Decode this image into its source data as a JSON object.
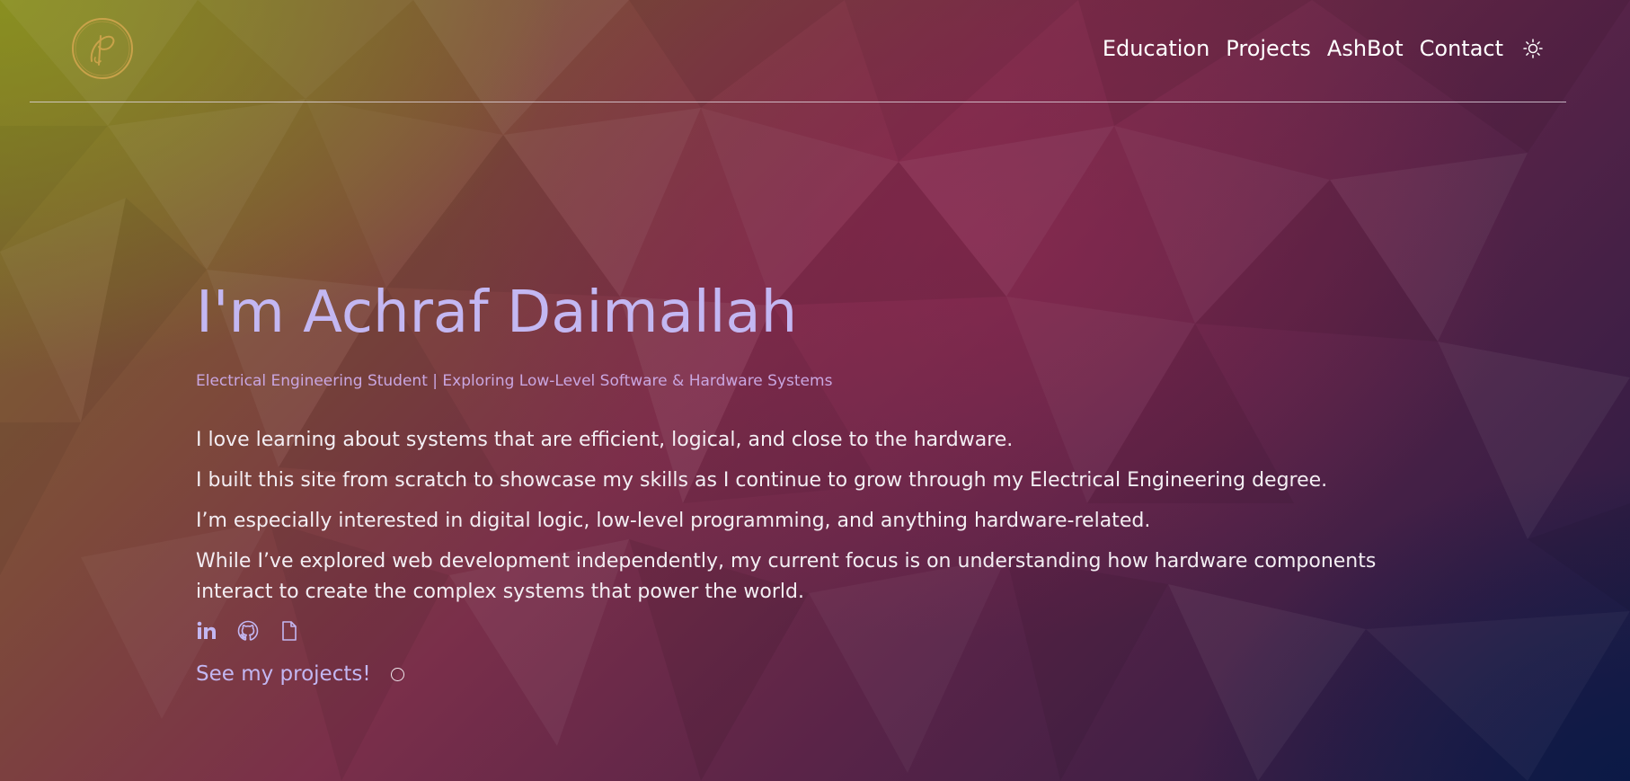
{
  "nav": {
    "links": [
      "Education",
      "Projects",
      "AshBot",
      "Contact"
    ],
    "theme_toggle_icon": "sun-icon"
  },
  "logo": {
    "icon": "signature-logo-icon",
    "color": "#c9a24a"
  },
  "hero": {
    "title": "I'm Achraf Daimallah",
    "subtitle": "Electrical Engineering Student | Exploring Low-Level Software & Hardware Systems",
    "paragraphs": [
      "I love learning about systems that are efficient, logical, and close to the hardware.",
      "I built this site from scratch to showcase my skills as I continue to grow through my Electrical Engineering degree.",
      "I’m especially interested in digital logic, low-level programming, and anything hardware-related.",
      "While I’ve explored web development independently, my current focus is on understanding how hardware components interact to create the complex systems that power the world."
    ],
    "social_icons": [
      "linkedin-icon",
      "github-icon",
      "document-icon"
    ],
    "cta_label": "See my projects!"
  },
  "colors": {
    "accent": "#c3b7f2",
    "subtitle": "#c9a6e0",
    "logo_gold": "#c9a24a"
  }
}
